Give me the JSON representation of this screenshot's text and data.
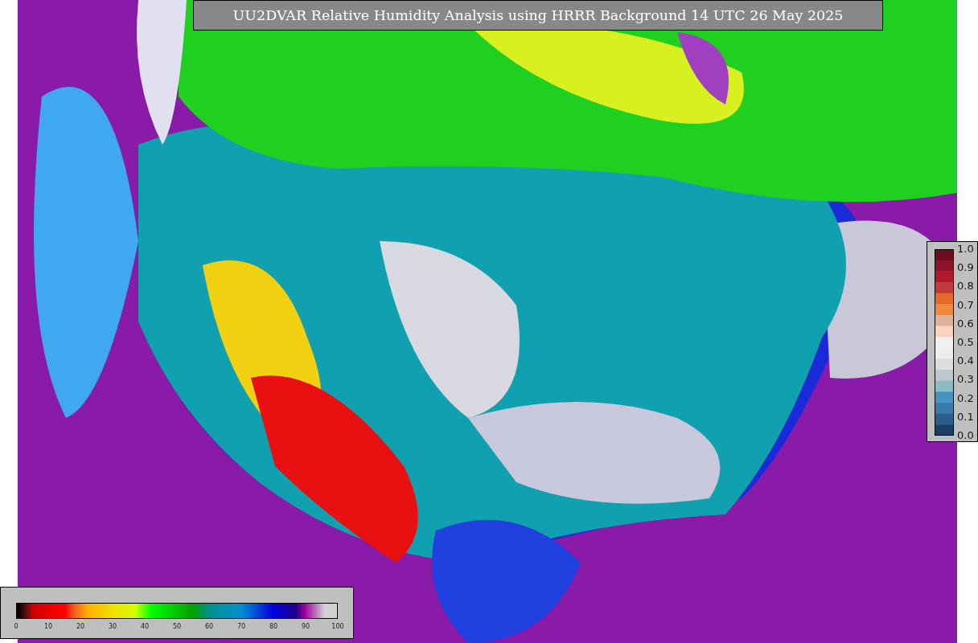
{
  "title": "UU2DVAR Relative Humidity Analysis using HRRR Background 14 UTC 26 May 2025",
  "observation_colorbar": {
    "ticks": [
      "1.0",
      "0.9",
      "0.8",
      "0.7",
      "0.6",
      "0.5",
      "0.4",
      "0.3",
      "0.2",
      "0.1",
      "0.0"
    ]
  },
  "humidity_colorbar": {
    "ticks": [
      "0",
      "10",
      "20",
      "30",
      "40",
      "50",
      "60",
      "70",
      "80",
      "90",
      "100"
    ]
  }
}
